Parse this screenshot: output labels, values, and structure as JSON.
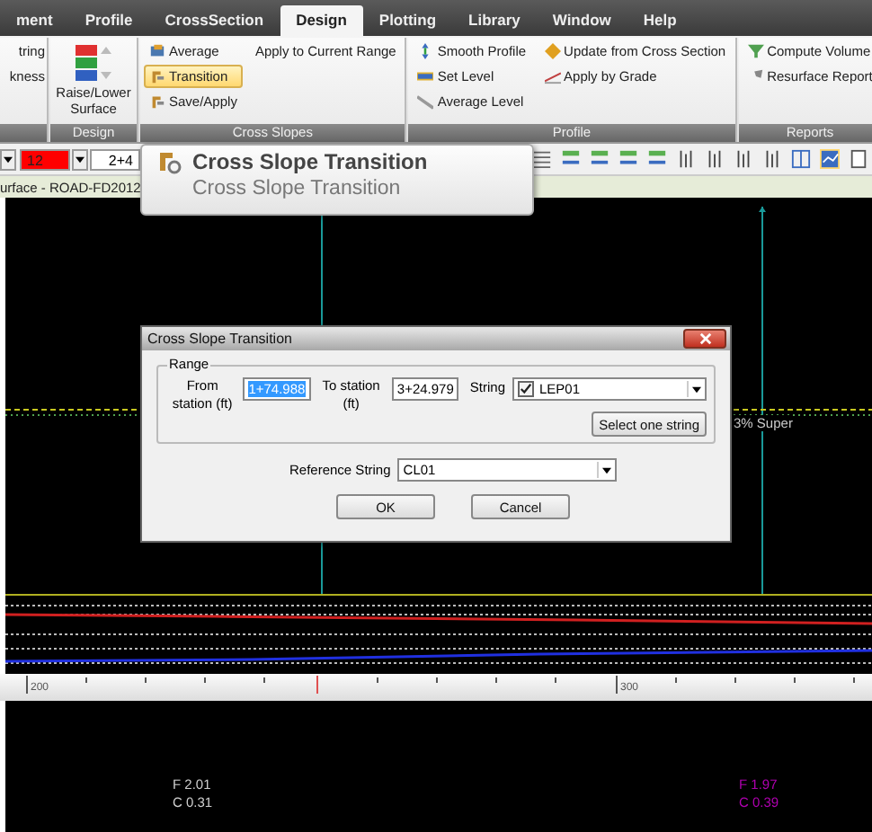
{
  "menu_tabs": [
    {
      "label": "ment",
      "selected": false
    },
    {
      "label": "Profile",
      "selected": false
    },
    {
      "label": "CrossSection",
      "selected": false
    },
    {
      "label": "Design",
      "selected": true
    },
    {
      "label": "Plotting",
      "selected": false
    },
    {
      "label": "Library",
      "selected": false
    },
    {
      "label": "Window",
      "selected": false
    },
    {
      "label": "Help",
      "selected": false
    }
  ],
  "ribbon_groups": [
    {
      "columns": [
        [
          {
            "label": "tring",
            "kind": "text",
            "selected": false
          },
          {
            "label": "kness",
            "kind": "text",
            "selected": false
          }
        ]
      ]
    },
    {
      "title": "Design",
      "columns": [
        [
          {
            "label": "Raise/Lower Surface",
            "kind": "raise",
            "selected": false
          }
        ]
      ]
    },
    {
      "title": "Cross Slopes",
      "columns": [
        [
          {
            "label": "Average",
            "kind": "average",
            "selected": false
          },
          {
            "label": "Transition",
            "kind": "transition",
            "selected": true
          },
          {
            "label": "Save/Apply",
            "kind": "transition",
            "selected": false
          }
        ],
        [
          {
            "label": "Apply to Current Range",
            "kind": "text",
            "selected": false
          }
        ]
      ]
    },
    {
      "title": "Profile",
      "columns": [
        [
          {
            "label": "Smooth Profile",
            "kind": "smooth",
            "selected": false
          },
          {
            "label": "Set Level",
            "kind": "level",
            "selected": false
          },
          {
            "label": "Average Level",
            "kind": "slope",
            "selected": false
          }
        ],
        [
          {
            "label": "Update from Cross Section",
            "kind": "update",
            "selected": false
          },
          {
            "label": "Apply by Grade",
            "kind": "grade",
            "selected": false
          }
        ]
      ]
    },
    {
      "title": "Reports",
      "columns": [
        [
          {
            "label": "Compute Volume",
            "kind": "volume",
            "selected": false
          },
          {
            "label": "Resurface Report",
            "kind": "report",
            "selected": false
          }
        ]
      ]
    }
  ],
  "toolbar": {
    "layer_field": "12",
    "station_field": "2+4"
  },
  "document_tab": "urface - ROAD-FD2012",
  "tooltip": {
    "title": "Cross Slope Transition",
    "description": "Cross Slope Transition"
  },
  "canvas": {
    "label": "3% Super"
  },
  "ruler": [
    {
      "label": "200"
    },
    {
      "label": "300"
    }
  ],
  "readouts": [
    {
      "lines": [
        "F 2.01",
        "C 0.31"
      ],
      "color": "#d0d0d0"
    },
    {
      "lines": [
        "F 1.97",
        "C 0.39"
      ],
      "color": "#b000b0"
    }
  ],
  "dialog": {
    "title": "Cross Slope Transition",
    "group": "Range",
    "from_label": "From station (ft)",
    "from_value": "1+74.988",
    "from_selected": true,
    "to_label": "To station (ft)",
    "to_value": "3+24.979",
    "string_label": "String",
    "string_value": "LEP01",
    "string_checked": true,
    "select_button": "Select one string",
    "reference_label": "Reference String",
    "reference_value": "CL01",
    "buttons": [
      "OK",
      "Cancel"
    ]
  }
}
